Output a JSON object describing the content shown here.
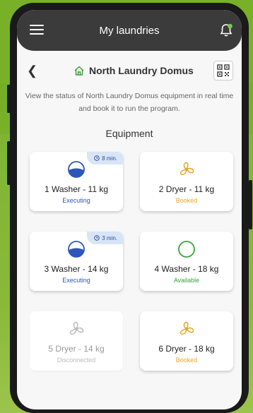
{
  "appbar": {
    "title": "My laundries"
  },
  "header": {
    "title": "North Laundry Domus"
  },
  "description": "View the status of North Laundry Domus equipment in real time and book it to run the program.",
  "section_title": "Equipment",
  "equipment": [
    {
      "name": "1 Washer - 11 kg",
      "status": "Executing",
      "timer": "8 min.",
      "type": "washer"
    },
    {
      "name": "2 Dryer - 11 kg",
      "status": "Booked",
      "type": "dryer"
    },
    {
      "name": "3 Washer - 14 kg",
      "status": "Executing",
      "timer": "3 min.",
      "type": "washer"
    },
    {
      "name": "4 Washer - 18 kg",
      "status": "Available",
      "type": "washer"
    },
    {
      "name": "5 Dryer - 14 kg",
      "status": "Disconnected",
      "type": "dryer"
    },
    {
      "name": "6 Dryer - 18 kg",
      "status": "Booked",
      "type": "dryer"
    }
  ],
  "colors": {
    "executing": "#2c56b8",
    "booked": "#e6a82a",
    "available": "#3aa23a",
    "disconnected": "#bbbbbb"
  }
}
